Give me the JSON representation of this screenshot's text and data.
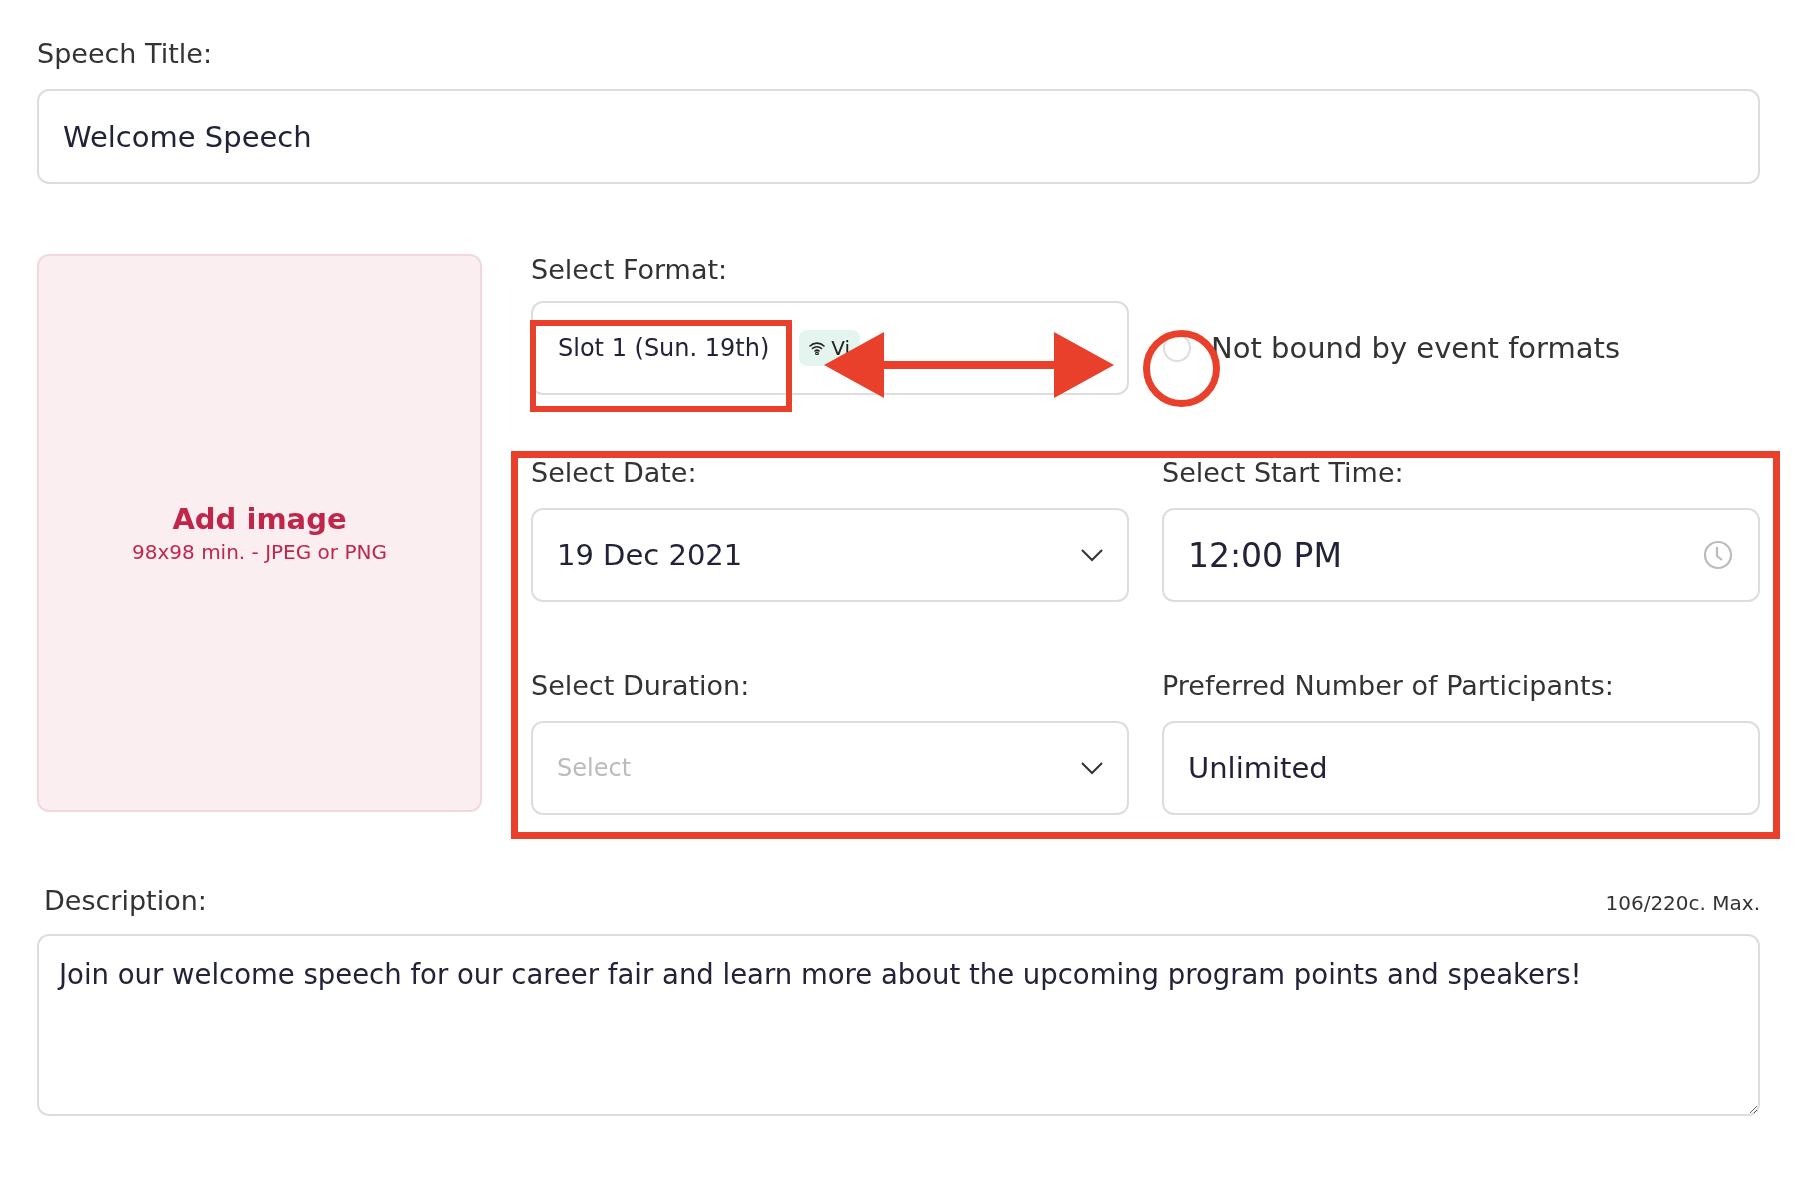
{
  "title": {
    "label": "Speech Title:",
    "value": "Welcome Speech"
  },
  "image": {
    "label": "Add image",
    "hint": "98x98 min. - JPEG or PNG"
  },
  "format": {
    "label": "Select Format:",
    "value": "Slot 1 (Sun. 19th)",
    "tag": "Vi"
  },
  "unbound": {
    "label": "Not bound by event formats",
    "checked": false
  },
  "date": {
    "label": "Select Date:",
    "value": "19 Dec 2021"
  },
  "start_time": {
    "label": "Select Start Time:",
    "value": "12:00 PM"
  },
  "duration": {
    "label": "Select Duration:",
    "placeholder": "Select"
  },
  "participants": {
    "label": "Preferred Number of Participants:",
    "value": "Unlimited"
  },
  "description": {
    "label": "Description:",
    "counter": "106/220c. Max.",
    "value": "Join our welcome speech for our career fair and learn more about the upcoming program points and speakers!"
  }
}
